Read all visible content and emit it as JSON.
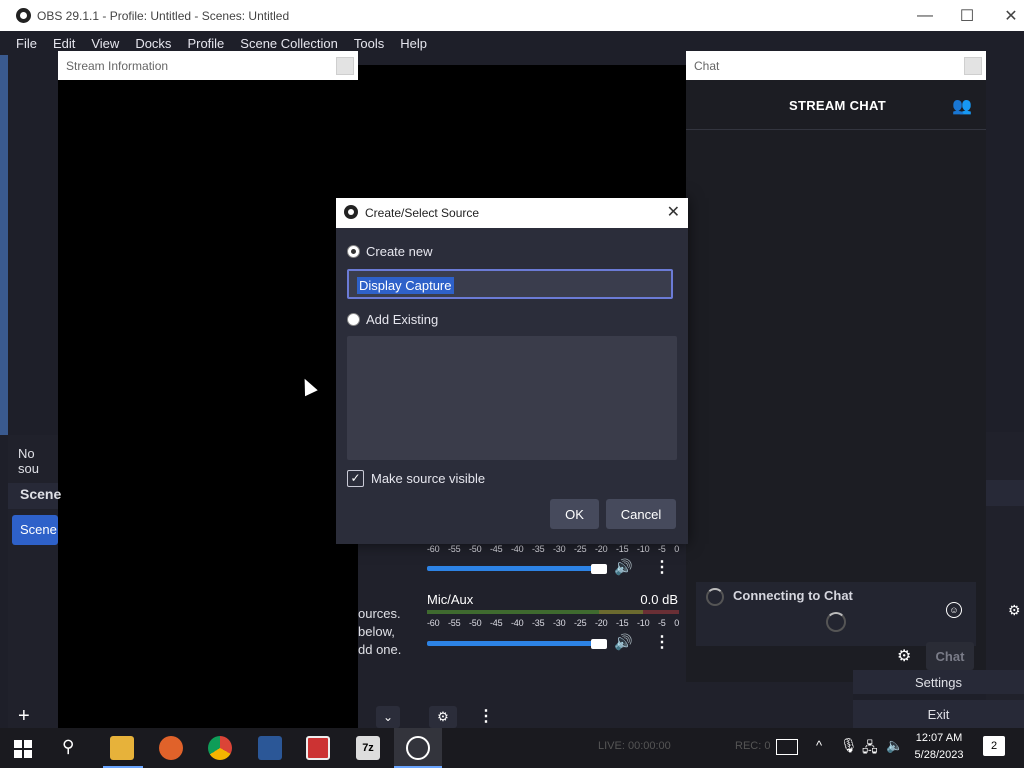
{
  "window": {
    "title": "OBS 29.1.1 - Profile: Untitled - Scenes: Untitled",
    "controls": [
      "—",
      "☐",
      "✕"
    ]
  },
  "menu": [
    "File",
    "Edit",
    "View",
    "Docks",
    "Profile",
    "Scene Collection",
    "Tools",
    "Help"
  ],
  "docks": {
    "stream_info": {
      "title": "Stream Information"
    },
    "chat": {
      "title": "Chat"
    }
  },
  "left": {
    "no_source": "No sou",
    "scenes_label": "Scene",
    "scene_item": "Scene",
    "add_symbol": "+"
  },
  "sources_hint": {
    "line1": "ources.",
    "line2": "below,",
    "line3": "dd one."
  },
  "modal": {
    "title": "Create/Select Source",
    "close": "✕",
    "create_new": "Create new",
    "name_value": "Display Capture",
    "add_existing": "Add Existing",
    "make_visible": "Make source visible",
    "ok": "OK",
    "cancel": "Cancel",
    "create_new_selected": true,
    "make_visible_checked": true
  },
  "mixer": {
    "ticks": [
      "-60",
      "-55",
      "-50",
      "-45",
      "-40",
      "-35",
      "-30",
      "-25",
      "-20",
      "-15",
      "-10",
      "-5",
      "0"
    ],
    "track1": {
      "name": "",
      "db": ""
    },
    "track2": {
      "name": "Mic/Aux",
      "db": "0.0 dB"
    }
  },
  "chat": {
    "header": "STREAM CHAT",
    "status": "Connecting to Chat",
    "send_button": "Chat"
  },
  "controls": {
    "settings": "Settings",
    "exit": "Exit"
  },
  "status_bar": {
    "live": "LIVE: 00:00:00",
    "rec": "REC: 0"
  },
  "taskbar": {
    "time": "12:07 AM",
    "date": "5/28/2023",
    "notifications": "2"
  },
  "colors": {
    "accent": "#2e61c9",
    "panel": "#20212b",
    "fader": "#2d83e5"
  },
  "full_text": {
    "no_source": "No source selected"
  }
}
